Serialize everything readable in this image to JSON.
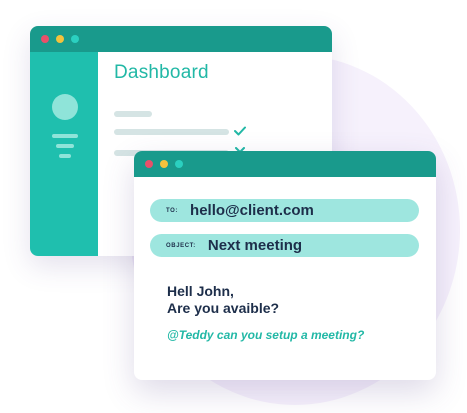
{
  "dashboard_window": {
    "title": "Dashboard"
  },
  "email_window": {
    "to": {
      "label": "TO:",
      "value": "hello@client.com"
    },
    "object": {
      "label": "OBJECT:",
      "value": "Next meeting"
    },
    "body_lines": [
      "Hell John,",
      "Are you avaible?"
    ],
    "mention": "@Teddy can you setup a meeting?"
  },
  "colors": {
    "titlebar": "#199a8c",
    "sidebar": "#1fbfae",
    "accent": "#22b8a6",
    "field_bg": "#9ee6df",
    "text_dark": "#1d2e4a",
    "close": "#e9506a",
    "minimize": "#f4c23c",
    "maximize": "#2bd0c0"
  }
}
